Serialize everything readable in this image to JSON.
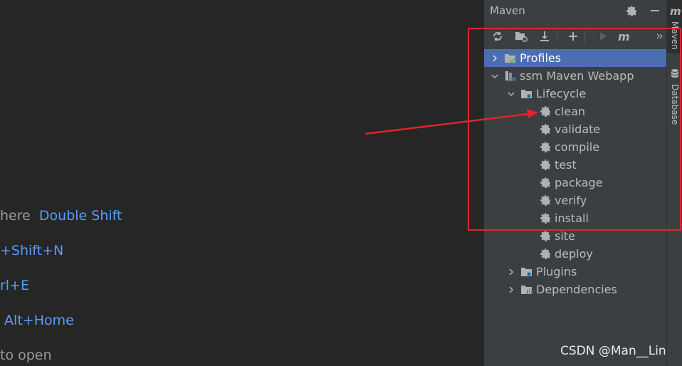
{
  "editor": {
    "hints": [
      {
        "text": "here",
        "key": "Double Shift"
      },
      {
        "text": "",
        "key": "+Shift+N"
      },
      {
        "text": "",
        "key": "rl+E"
      },
      {
        "text": "",
        "key": "Alt+Home"
      },
      {
        "text": "to open",
        "key": ""
      }
    ]
  },
  "maven": {
    "title": "Maven",
    "toolbar": [
      "reload-icon",
      "generate-sources-icon",
      "download-icon",
      "add-icon",
      "run-icon",
      "maven-goal-icon",
      "more-icon"
    ],
    "tree": {
      "profiles": "Profiles",
      "project": "ssm Maven Webapp",
      "lifecycle": "Lifecycle",
      "phases": [
        "clean",
        "validate",
        "compile",
        "test",
        "package",
        "verify",
        "install",
        "site",
        "deploy"
      ],
      "plugins": "Plugins",
      "dependencies": "Dependencies"
    }
  },
  "stripe": {
    "maven_tab": "Maven",
    "database_tab": "Database"
  },
  "watermark": "CSDN @Man__Lin",
  "colors": {
    "selection": "#4b6eaf",
    "link_key": "#589df6",
    "annotation": "#e0242b"
  }
}
